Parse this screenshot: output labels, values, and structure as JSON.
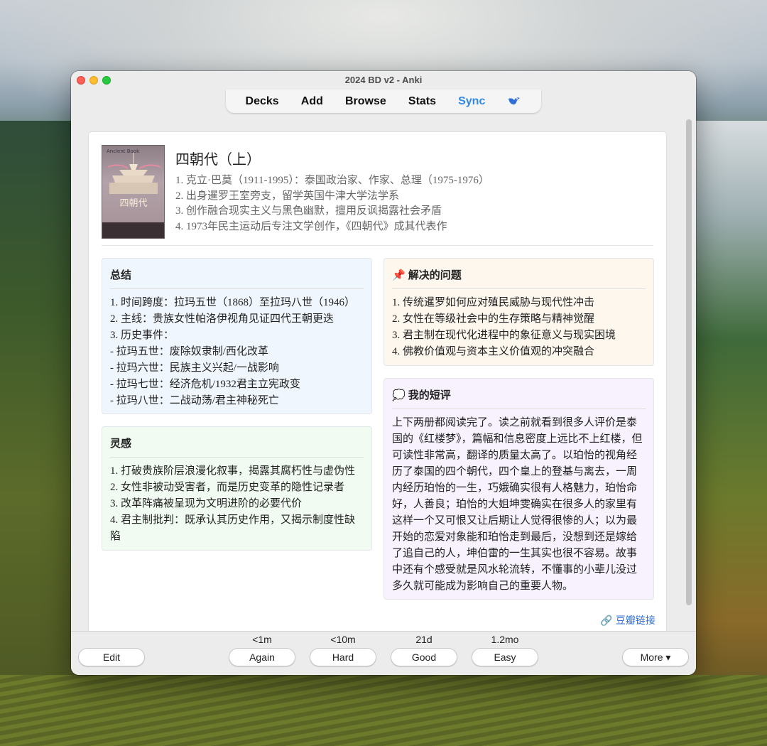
{
  "window": {
    "title": "2024 BD v2 - Anki"
  },
  "toolbar": {
    "decks": "Decks",
    "add": "Add",
    "browse": "Browse",
    "stats": "Stats",
    "sync": "Sync",
    "sync_icon": "ankiweb-bird-icon"
  },
  "book": {
    "cover_top": "Ancient Book",
    "cover_title": "四朝代",
    "title": "四朝代（上）",
    "lines": [
      "1. 克立·巴莫（1911-1995）：泰国政治家、作家、总理（1975-1976）",
      "2. 出身暹罗王室旁支，留学英国牛津大学法学系",
      "3. 创作融合现实主义与黑色幽默，擅用反讽揭露社会矛盾",
      "4. 1973年民主运动后专注文学创作，《四朝代》成其代表作"
    ]
  },
  "summary": {
    "title": "总结",
    "lines": [
      "1. 时间跨度：拉玛五世（1868）至拉玛八世（1946）",
      "2. 主线：贵族女性帕洛伊视角见证四代王朝更迭",
      "3. 历史事件：",
      "- 拉玛五世：废除奴隶制/西化改革",
      "- 拉玛六世：民族主义兴起/一战影响",
      "- 拉玛七世：经济危机/1932君主立宪政变",
      "- 拉玛八世：二战动荡/君主神秘死亡"
    ]
  },
  "inspiration": {
    "title": "灵感",
    "lines": [
      "1. 打破贵族阶层浪漫化叙事，揭露其腐朽性与虚伪性",
      "2. 女性非被动受害者，而是历史变革的隐性记录者",
      "3. 改革阵痛被呈现为文明进阶的必要代价",
      "4. 君主制批判：既承认其历史作用，又揭示制度性缺陷"
    ]
  },
  "solved": {
    "icon": "📌",
    "title": "解决的问题",
    "lines": [
      "1. 传统暹罗如何应对殖民威胁与现代性冲击",
      "2. 女性在等级社会中的生存策略与精神觉醒",
      "3. 君主制在现代化进程中的象征意义与现实困境",
      "4. 佛教价值观与资本主义价值观的冲突融合"
    ]
  },
  "review": {
    "icon": "💭",
    "title": "我的短评",
    "text": "上下两册都阅读完了。读之前就看到很多人评价是泰国的《红楼梦》，篇幅和信息密度上远比不上红楼，但可读性非常高，翻译的质量太高了。以珀怡的视角经历了泰国的四个朝代，四个皇上的登基与离去，一周内经历珀怡的一生，巧娥确实很有人格魅力，珀怡命好，人善良；珀怡的大姐坤雯确实在很多人的家里有这样一个又可恨又让后期让人觉得很惨的人；以为最开始的恋爱对象能和珀怡走到最后，没想到还是嫁给了追自己的人，坤伯雷的一生其实也很不容易。故事中还有个感受就是风水轮流转，不懂事的小辈儿没过多久就可能成为影响自己的重要人物。"
  },
  "link": {
    "icon": "🔗",
    "label": "豆瓣链接"
  },
  "bottom": {
    "edit": "Edit",
    "more": "More ▾",
    "answers": [
      {
        "due": "<1m",
        "label": "Again"
      },
      {
        "due": "<10m",
        "label": "Hard"
      },
      {
        "due": "21d",
        "label": "Good"
      },
      {
        "due": "1.2mo",
        "label": "Easy"
      }
    ]
  }
}
